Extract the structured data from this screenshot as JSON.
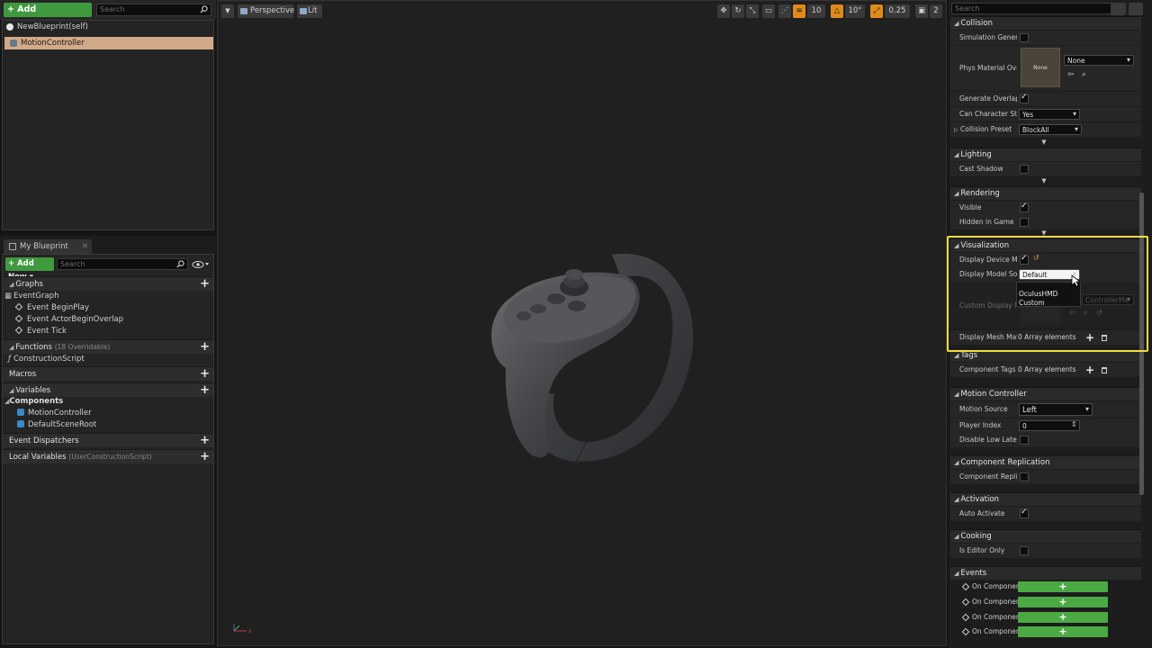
{
  "components": {
    "add_label": "+ Add Component ▾",
    "search_placeholder": "Search",
    "root": "NewBlueprint(self)",
    "selected": "MotionController"
  },
  "my_blueprint": {
    "tab_label": "My Blueprint",
    "tab_close": "✕",
    "add_new_label": "+ Add New ▾",
    "search_placeholder": "Search",
    "sections": {
      "graphs": "Graphs",
      "functions": "Functions",
      "functions_sub": "(18 Overridable)",
      "macros": "Macros",
      "variables": "Variables",
      "event_dispatchers": "Event Dispatchers",
      "local_variables": "Local Variables",
      "local_variables_sub": "(UserConstructionScript)"
    },
    "event_graph": "EventGraph",
    "events": [
      "Event BeginPlay",
      "Event ActorBeginOverlap",
      "Event Tick"
    ],
    "construction_script": "ConstructionScript",
    "components_header": "Components",
    "variables": [
      "MotionController",
      "DefaultSceneRoot"
    ]
  },
  "viewport": {
    "menu": "▼",
    "perspective": "Perspective",
    "lit": "Lit",
    "grid_snap": "10",
    "rot_snap": "10°",
    "scale_snap": "0.25",
    "camera_speed": "2"
  },
  "details": {
    "search_placeholder": "Search",
    "sections": {
      "collision": "Collision",
      "lighting": "Lighting",
      "rendering": "Rendering",
      "visualization": "Visualization",
      "tags": "Tags",
      "motion_controller": "Motion Controller",
      "component_replication": "Component Replication",
      "activation": "Activation",
      "cooking": "Cooking",
      "events": "Events"
    },
    "collision": {
      "sim_gen_label": "Simulation Genera",
      "phys_mat_label": "Phys Material Ove",
      "phys_mat_thumb": "None",
      "phys_mat_value": "None",
      "gen_overlap_label": "Generate Overlap I",
      "can_step_label": "Can Character Ste",
      "can_step_value": "Yes",
      "presets_label": "Collision Presets",
      "presets_value": "BlockAll"
    },
    "lighting": {
      "cast_shadow_label": "Cast Shadow"
    },
    "rendering": {
      "visible_label": "Visible",
      "hidden_label": "Hidden in Game"
    },
    "visualization": {
      "display_device_label": "Display Device Mo",
      "display_source_label": "Display Model Sou",
      "display_source_value": "Default",
      "custom_display_label": "Custom Display M",
      "custom_display_value": "ControllerMe",
      "mesh_mat_label": "Display Mesh Mate",
      "mesh_mat_value": "0 Array elements",
      "popup_options": [
        "OculusHMD",
        "Custom"
      ]
    },
    "tags": {
      "component_tags_label": "Component Tags",
      "component_tags_value": "0 Array elements"
    },
    "motion": {
      "source_label": "Motion Source",
      "source_value": "Left",
      "player_index_label": "Player Index",
      "player_index_value": "0",
      "low_latency_label": "Disable Low Laten"
    },
    "replication": {
      "label": "Component Replic"
    },
    "activation": {
      "auto_label": "Auto Activate"
    },
    "cooking": {
      "editor_only_label": "Is Editor Only"
    },
    "events": [
      "On Componen",
      "On Componen",
      "On Componen",
      "On Componen"
    ]
  }
}
